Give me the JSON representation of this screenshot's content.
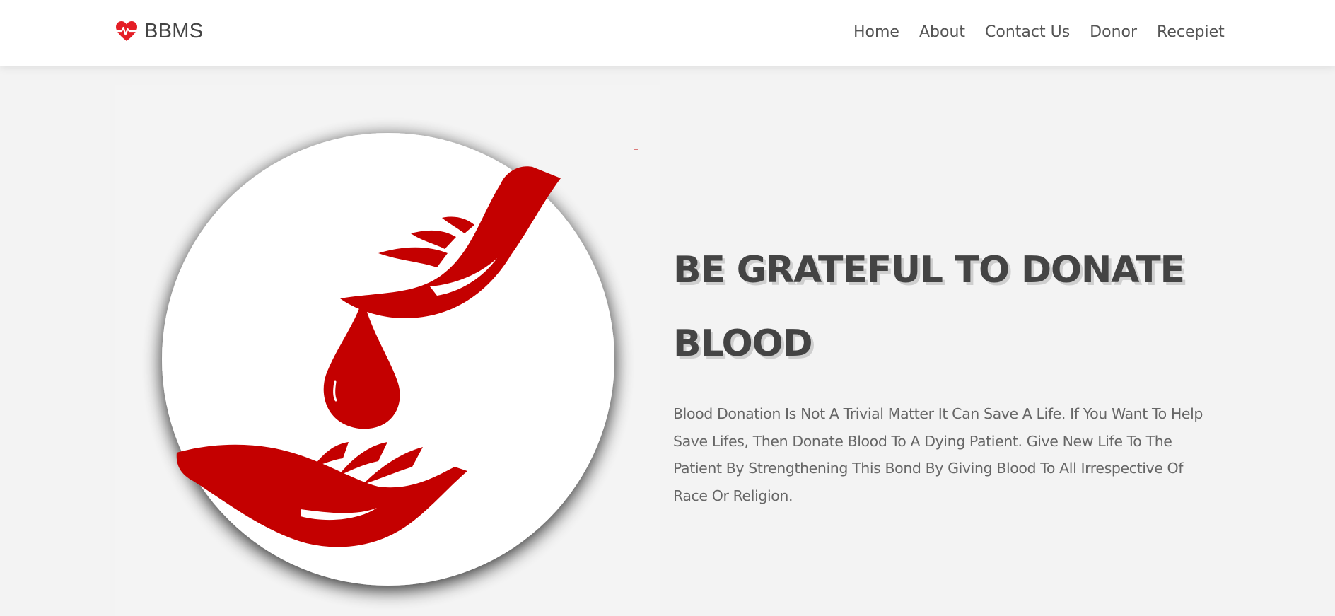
{
  "navbar": {
    "brand": {
      "name": "BBMS",
      "icon": "heart-pulse-icon",
      "icon_color": "#e41e26"
    },
    "links": [
      {
        "label": "Home"
      },
      {
        "label": "About"
      },
      {
        "label": "Contact Us"
      },
      {
        "label": "Donor"
      },
      {
        "label": "Recepiet"
      }
    ]
  },
  "hero": {
    "title": "BE GRATEFUL TO DONATE BLOOD",
    "description": "Blood Donation Is Not A Trivial Matter It Can Save A Life. If You Want To Help Save Lifes, Then Donate Blood To A Dying Patient. Give New Life To The Patient By Strengthening This Bond By Giving Blood To All Irrespective Of Race Or Religion.",
    "image": "blood-donation-hands-illustration"
  },
  "colors": {
    "brand_red": "#c40000",
    "heading": "#444444",
    "text": "#666666",
    "background": "#f3f3f3"
  }
}
